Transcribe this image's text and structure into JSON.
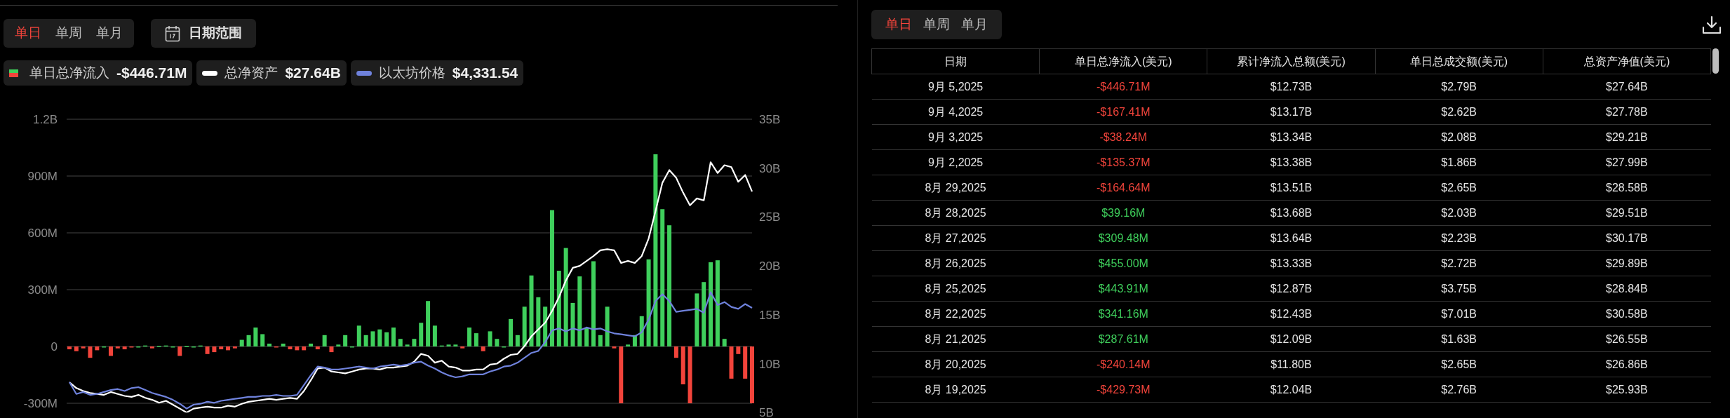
{
  "chart_panel": {
    "period_tabs": [
      {
        "label": "单日",
        "selected": true
      },
      {
        "label": "单周",
        "selected": false
      },
      {
        "label": "单月",
        "selected": false
      }
    ],
    "date_range_button": {
      "label": "日期范围"
    },
    "legend_values": [
      "-$446.71M",
      "$27.64B",
      "$4,331.54"
    ],
    "chart_data": {
      "type": "bar",
      "stacked": true,
      "grid": true,
      "ylim": [
        -300000000.0,
        1200000000.0
      ],
      "yticks": [
        {
          "value": -300000000.0,
          "label": "-300M"
        },
        {
          "value": 0,
          "label": "0"
        },
        {
          "value": 300000000.0,
          "label": "300M"
        },
        {
          "value": 600000000.0,
          "label": "600M"
        },
        {
          "value": 900000000.0,
          "label": "900M"
        },
        {
          "value": 1200000000.0,
          "label": "1.2B"
        }
      ],
      "y2lim": [
        5000000000.0,
        35000000000.0
      ],
      "y2ticks": [
        {
          "value": 5000000000.0,
          "label": "5B"
        },
        {
          "value": 10000000000.0,
          "label": "10B"
        },
        {
          "value": 15000000000.0,
          "label": "15B"
        },
        {
          "value": 20000000000.0,
          "label": "20B"
        },
        {
          "value": 25000000000.0,
          "label": "25B"
        },
        {
          "value": 30000000000.0,
          "label": "30B"
        },
        {
          "value": 35000000000.0,
          "label": "35B"
        }
      ],
      "series": [
        {
          "name": "单日总净流入",
          "color": "#3fcf5c",
          "values": [
            null,
            null,
            null,
            null,
            null,
            0,
            null,
            null,
            null,
            null,
            0,
            5000000.0,
            null,
            3000000.0,
            5000000.0,
            0,
            null,
            2000000.0,
            0,
            5000000.0,
            null,
            null,
            null,
            null,
            null,
            35000000.0,
            60000000.0,
            100000000.0,
            65000000.0,
            15000000.0,
            null,
            15000000.0,
            null,
            null,
            null,
            15000000.0,
            null,
            60000000.0,
            null,
            10000000.0,
            60000000.0,
            0,
            110000000.0,
            60000000.0,
            80000000.0,
            90000000.0,
            75000000.0,
            100000000.0,
            40000000.0,
            10000000.0,
            40000000.0,
            125000000.0,
            240000000.0,
            110000000.0,
            5000000.0,
            10000000.0,
            10000000.0,
            null,
            100000000.0,
            70000000.0,
            null,
            80000000.0,
            40000000.0,
            0,
            145000000.0,
            60000000.0,
            210000000.0,
            375000000.0,
            260000000.0,
            210000000.0,
            720000000.0,
            400000000.0,
            520000000.0,
            230000000.0,
            370000000.0,
            100000000.0,
            450000000.0,
            60000000.0,
            210000000.0,
            null,
            null,
            10000000.0,
            60000000.0,
            160000000.0,
            460000000.0,
            1015000000.0,
            725000000.0,
            640000000.0,
            null,
            null,
            null,
            280000000.0,
            340000000.0,
            445000000.0,
            455000000.0,
            40000000.0,
            null,
            null,
            null,
            null
          ]
        },
        {
          "name": "总净资产",
          "type": "line",
          "axis": "y2",
          "color": "#ffffff",
          "values": [
            8100000000.0,
            7500000000.0,
            7200000000.0,
            7000000000.0,
            6900000000.0,
            6800000000.0,
            7100000000.0,
            6900000000.0,
            6700000000.0,
            6600000000.0,
            6800000000.0,
            6500000000.0,
            6300000000.0,
            6000000000.0,
            6200000000.0,
            5800000000.0,
            5400000000.0,
            5000000000.0,
            5400000000.0,
            5500000000.0,
            5600000000.0,
            5500000000.0,
            5500000000.0,
            5700000000.0,
            5600000000.0,
            5900000000.0,
            6100000000.0,
            6200000000.0,
            6300000000.0,
            6400000000.0,
            6300000000.0,
            6400000000.0,
            6500000000.0,
            6400000000.0,
            7200000000.0,
            8300000000.0,
            9500000000.0,
            9600000000.0,
            9200000000.0,
            9100000000.0,
            9000000000.0,
            9200000000.0,
            9400000000.0,
            9500000000.0,
            9500000000.0,
            9400000000.0,
            9600000000.0,
            9600000000.0,
            9700000000.0,
            9800000000.0,
            10200000000.0,
            11000000000.0,
            10800000000.0,
            10100000000.0,
            10300000000.0,
            9700000000.0,
            9600000000.0,
            9300000000.0,
            9300000000.0,
            9400000000.0,
            9400000000.0,
            9900000000.0,
            10000000000.0,
            10500000000.0,
            10900000000.0,
            11000000000.0,
            11800000000.0,
            12800000000.0,
            13500000000.0,
            14200000000.0,
            15400000000.0,
            16800000000.0,
            18500000000.0,
            19800000000.0,
            20000000000.0,
            20500000000.0,
            21000000000.0,
            21600000000.0,
            21700000000.0,
            21600000000.0,
            20300000000.0,
            20500000000.0,
            20300000000.0,
            21000000000.0,
            22800000000.0,
            25600000000.0,
            28500000000.0,
            29800000000.0,
            29000000000.0,
            27500000000.0,
            26200000000.0,
            26900000000.0,
            26700000000.0,
            30600000000.0,
            29500000000.0,
            30300000000.0,
            30100000000.0,
            28600000000.0,
            29300000000.0,
            27600000000.0
          ]
        },
        {
          "name": "以太坊价格",
          "type": "line",
          "axis": "y2",
          "color": "#6f82dc",
          "values": [
            8100000000.0,
            6900000000.0,
            7100000000.0,
            6800000000.0,
            6900000000.0,
            7100000000.0,
            7300000000.0,
            7400000000.0,
            7200000000.0,
            7500000000.0,
            7600000000.0,
            7300000000.0,
            7000000000.0,
            6800000000.0,
            6600000000.0,
            6300000000.0,
            5900000000.0,
            5400000000.0,
            5800000000.0,
            5900000000.0,
            6100000000.0,
            6000000000.0,
            6200000000.0,
            6300000000.0,
            6400000000.0,
            6500000000.0,
            6600000000.0,
            6600000000.0,
            6700000000.0,
            6700000000.0,
            6800000000.0,
            6700000000.0,
            6700000000.0,
            6800000000.0,
            7800000000.0,
            8800000000.0,
            9700000000.0,
            9600000000.0,
            9400000000.0,
            9400000000.0,
            9500000000.0,
            9600000000.0,
            9700000000.0,
            9600000000.0,
            9500000000.0,
            9700000000.0,
            9800000000.0,
            9900000000.0,
            9800000000.0,
            9900000000.0,
            10100000000.0,
            10200000000.0,
            9800000000.0,
            9500000000.0,
            9100000000.0,
            8800000000.0,
            8600000000.0,
            8700000000.0,
            8900000000.0,
            8900000000.0,
            8900000000.0,
            9200000000.0,
            9400000000.0,
            9700000000.0,
            9800000000.0,
            10100000000.0,
            10600000000.0,
            11100000000.0,
            11300000000.0,
            12200000000.0,
            13400000000.0,
            13600000000.0,
            13300000000.0,
            13600000000.0,
            13400000000.0,
            13700000000.0,
            13500000000.0,
            13600000000.0,
            13300000000.0,
            13100000000.0,
            13000000000.0,
            12900000000.0,
            12800000000.0,
            13200000000.0,
            14500000000.0,
            16400000000.0,
            17100000000.0,
            16400000000.0,
            15300000000.0,
            15400000000.0,
            15500000000.0,
            15600000000.0,
            15200000000.0,
            17300000000.0,
            16000000000.0,
            16300000000.0,
            15800000000.0,
            15600000000.0,
            16100000000.0,
            15700000000.0
          ]
        },
        {
          "color": "#f2443b",
          "values": [
            -15000000.0,
            -25000000.0,
            -10000000.0,
            -60000000.0,
            -20000000.0,
            null,
            -50000000.0,
            -10000000.0,
            -15000000.0,
            -5000000.0,
            null,
            null,
            -10000000.0,
            null,
            null,
            null,
            -50000000.0,
            null,
            null,
            null,
            -40000000.0,
            -30000000.0,
            -15000000.0,
            -20000000.0,
            -10000000.0,
            null,
            null,
            null,
            null,
            null,
            -5000000.0,
            null,
            -15000000.0,
            -20000000.0,
            -20000000.0,
            null,
            -15000000.0,
            null,
            -30000000.0,
            null,
            null,
            null,
            null,
            null,
            null,
            null,
            null,
            null,
            null,
            null,
            null,
            null,
            null,
            null,
            null,
            null,
            null,
            -10000000.0,
            null,
            null,
            -25000000.0,
            null,
            null,
            null,
            null,
            null,
            null,
            null,
            null,
            null,
            null,
            null,
            null,
            null,
            null,
            null,
            null,
            null,
            null,
            -10000000.0,
            -300000000.0,
            null,
            null,
            null,
            null,
            null,
            null,
            null,
            -60000000.0,
            -200000000.0,
            -300000000.0,
            null,
            null,
            null,
            null,
            null,
            -170000000.0,
            -40000000.0,
            -170000000.0,
            -300000000.0
          ]
        }
      ]
    }
  },
  "table_panel": {
    "period_tabs": [
      {
        "label": "单日",
        "selected": true
      },
      {
        "label": "单周",
        "selected": false
      },
      {
        "label": "单月",
        "selected": false
      }
    ],
    "columns": [
      "日期",
      "单日总净流入(美元)",
      "累计净流入总额(美元)",
      "单日总成交额(美元)",
      "总资产净值(美元)"
    ],
    "rows": [
      {
        "date": "9月 5,2025",
        "net_inflow": "-$446.71M",
        "color": "#f2443b",
        "cumulative": "$12.73B",
        "volume": "$2.79B",
        "net_assets": "$27.64B"
      },
      {
        "date": "9月 4,2025",
        "net_inflow": "-$167.41M",
        "color": "#f2443b",
        "cumulative": "$13.17B",
        "volume": "$2.62B",
        "net_assets": "$27.78B"
      },
      {
        "date": "9月 3,2025",
        "net_inflow": "-$38.24M",
        "color": "#f2443b",
        "cumulative": "$13.34B",
        "volume": "$2.08B",
        "net_assets": "$29.21B"
      },
      {
        "date": "9月 2,2025",
        "net_inflow": "-$135.37M",
        "color": "#f2443b",
        "cumulative": "$13.38B",
        "volume": "$1.86B",
        "net_assets": "$27.99B"
      },
      {
        "date": "8月 29,2025",
        "net_inflow": "-$164.64M",
        "color": "#f2443b",
        "cumulative": "$13.51B",
        "volume": "$2.65B",
        "net_assets": "$28.58B"
      },
      {
        "date": "8月 28,2025",
        "net_inflow": "$39.16M",
        "color": "#3fcf5c",
        "cumulative": "$13.68B",
        "volume": "$2.03B",
        "net_assets": "$29.51B"
      },
      {
        "date": "8月 27,2025",
        "net_inflow": "$309.48M",
        "color": "#3fcf5c",
        "cumulative": "$13.64B",
        "volume": "$2.23B",
        "net_assets": "$30.17B"
      },
      {
        "date": "8月 26,2025",
        "net_inflow": "$455.00M",
        "color": "#3fcf5c",
        "cumulative": "$13.33B",
        "volume": "$2.72B",
        "net_assets": "$29.89B"
      },
      {
        "date": "8月 25,2025",
        "net_inflow": "$443.91M",
        "color": "#3fcf5c",
        "cumulative": "$12.87B",
        "volume": "$3.75B",
        "net_assets": "$28.84B"
      },
      {
        "date": "8月 22,2025",
        "net_inflow": "$341.16M",
        "color": "#3fcf5c",
        "cumulative": "$12.43B",
        "volume": "$7.01B",
        "net_assets": "$30.58B"
      },
      {
        "date": "8月 21,2025",
        "net_inflow": "$287.61M",
        "color": "#3fcf5c",
        "cumulative": "$12.09B",
        "volume": "$1.63B",
        "net_assets": "$26.55B"
      },
      {
        "date": "8月 20,2025",
        "net_inflow": "-$240.14M",
        "color": "#f2443b",
        "cumulative": "$11.80B",
        "volume": "$2.65B",
        "net_assets": "$26.86B"
      },
      {
        "date": "8月 19,2025",
        "net_inflow": "-$429.73M",
        "color": "#f2443b",
        "cumulative": "$12.04B",
        "volume": "$2.76B",
        "net_assets": "$25.93B"
      }
    ]
  }
}
